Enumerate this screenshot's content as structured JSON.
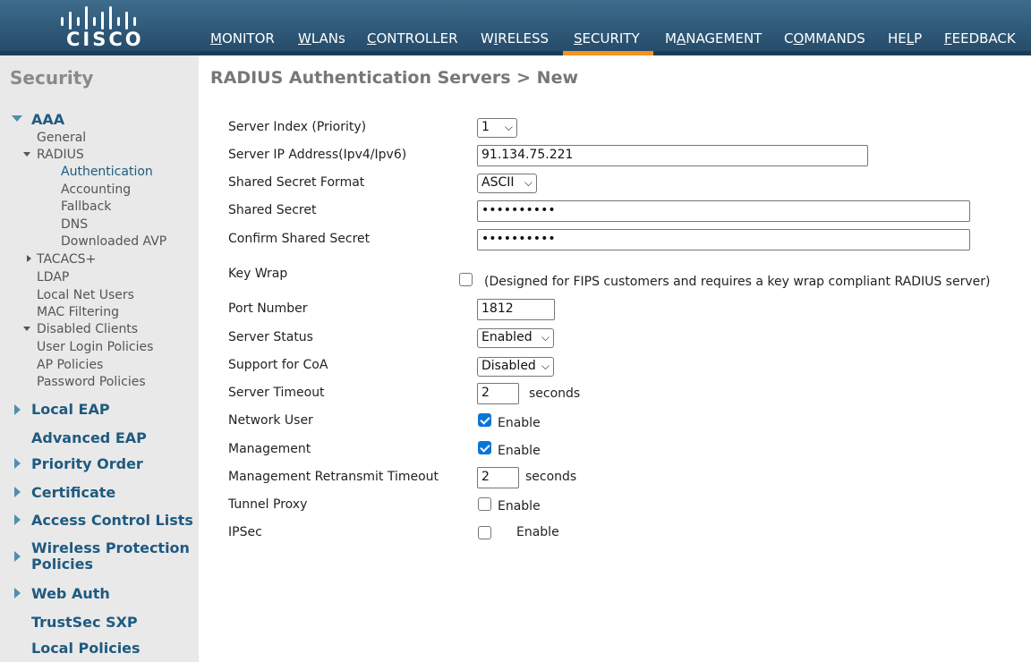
{
  "header": {
    "logo_text": "CISCO",
    "nav": [
      {
        "label_u": "M",
        "label_rest": "ONITOR"
      },
      {
        "label_u": "W",
        "label_rest": "LANs"
      },
      {
        "label_u": "C",
        "label_rest": "ONTROLLER"
      },
      {
        "label_pre": "W",
        "label_u": "I",
        "label_rest": "RELESS"
      },
      {
        "label_u": "S",
        "label_rest": "ECURITY"
      },
      {
        "label_pre": "M",
        "label_u": "A",
        "label_rest": "NAGEMENT"
      },
      {
        "label_pre": "C",
        "label_u": "O",
        "label_rest": "MMANDS"
      },
      {
        "label_pre": "HE",
        "label_u": "L",
        "label_rest": "P"
      },
      {
        "label_u": "F",
        "label_rest": "EEDBACK"
      }
    ],
    "active_nav": "SECURITY",
    "accent_color": "#f29421"
  },
  "sidebar": {
    "title": "Security",
    "aaa": "AAA",
    "general": "General",
    "radius": "RADIUS",
    "authentication": "Authentication",
    "accounting": "Accounting",
    "fallback": "Fallback",
    "dns": "DNS",
    "downloaded_avp": "Downloaded AVP",
    "tacacs": "TACACS+",
    "ldap": "LDAP",
    "local_net_users": "Local Net Users",
    "mac_filtering": "MAC Filtering",
    "disabled_clients": "Disabled Clients",
    "user_login_policies": "User Login Policies",
    "ap_policies": "AP Policies",
    "password_policies": "Password Policies",
    "local_eap": "Local EAP",
    "advanced_eap": "Advanced EAP",
    "priority_order": "Priority Order",
    "certificate": "Certificate",
    "access_control_lists": "Access Control Lists",
    "wireless_protection_1": "Wireless Protection",
    "wireless_protection_2": "Policies",
    "web_auth": "Web Auth",
    "trustsec_sxp": "TrustSec SXP",
    "local_policies": "Local Policies"
  },
  "main": {
    "title": "RADIUS Authentication Servers > New",
    "fields": {
      "server_index_label": "Server Index (Priority)",
      "server_index_value": "1",
      "server_ip_label": "Server IP Address(Ipv4/Ipv6)",
      "server_ip_value": "91.134.75.221",
      "secret_format_label": "Shared Secret Format",
      "secret_format_value": "ASCII",
      "shared_secret_label": "Shared Secret",
      "shared_secret_value": "••••••••••",
      "confirm_secret_label": "Confirm Shared Secret",
      "confirm_secret_value": "••••••••••",
      "key_wrap_label": "Key Wrap",
      "key_wrap_note": "(Designed for FIPS customers and requires a key wrap compliant RADIUS server)",
      "port_label": "Port Number",
      "port_value": "1812",
      "server_status_label": "Server Status",
      "server_status_value": "Enabled",
      "coa_label": "Support for CoA",
      "coa_value": "Disabled",
      "timeout_label": "Server Timeout",
      "timeout_value": "2",
      "timeout_unit": "seconds",
      "network_user_label": "Network User",
      "network_user_enable": "Enable",
      "management_label": "Management",
      "management_enable": "Enable",
      "mgmt_retransmit_label": "Management Retransmit Timeout",
      "mgmt_retransmit_value": "2",
      "mgmt_retransmit_unit": "seconds",
      "tunnel_proxy_label": "Tunnel Proxy",
      "tunnel_proxy_enable": "Enable",
      "ipsec_label": "IPSec",
      "ipsec_enable": "Enable"
    },
    "checkbox_states": {
      "key_wrap": false,
      "network_user": true,
      "management": true,
      "tunnel_proxy": false,
      "ipsec": false
    }
  }
}
